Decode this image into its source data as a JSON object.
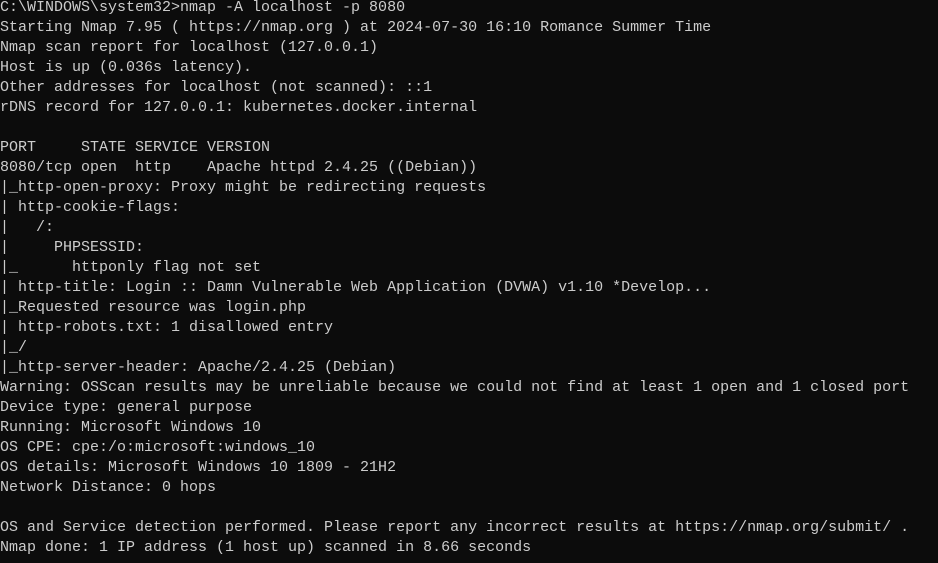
{
  "terminal": {
    "colors": {
      "background": "#0c0c0c",
      "foreground": "#cccccc"
    },
    "lines": [
      "C:\\WINDOWS\\system32>nmap -A localhost -p 8080",
      "Starting Nmap 7.95 ( https://nmap.org ) at 2024-07-30 16:10 Romance Summer Time",
      "Nmap scan report for localhost (127.0.0.1)",
      "Host is up (0.036s latency).",
      "Other addresses for localhost (not scanned): ::1",
      "rDNS record for 127.0.0.1: kubernetes.docker.internal",
      "",
      "PORT     STATE SERVICE VERSION",
      "8080/tcp open  http    Apache httpd 2.4.25 ((Debian))",
      "|_http-open-proxy: Proxy might be redirecting requests",
      "| http-cookie-flags:",
      "|   /:",
      "|     PHPSESSID:",
      "|_      httponly flag not set",
      "| http-title: Login :: Damn Vulnerable Web Application (DVWA) v1.10 *Develop...",
      "|_Requested resource was login.php",
      "| http-robots.txt: 1 disallowed entry",
      "|_/",
      "|_http-server-header: Apache/2.4.25 (Debian)",
      "Warning: OSScan results may be unreliable because we could not find at least 1 open and 1 closed port",
      "Device type: general purpose",
      "Running: Microsoft Windows 10",
      "OS CPE: cpe:/o:microsoft:windows_10",
      "OS details: Microsoft Windows 10 1809 - 21H2",
      "Network Distance: 0 hops",
      "",
      "OS and Service detection performed. Please report any incorrect results at https://nmap.org/submit/ .",
      "Nmap done: 1 IP address (1 host up) scanned in 8.66 seconds"
    ]
  }
}
